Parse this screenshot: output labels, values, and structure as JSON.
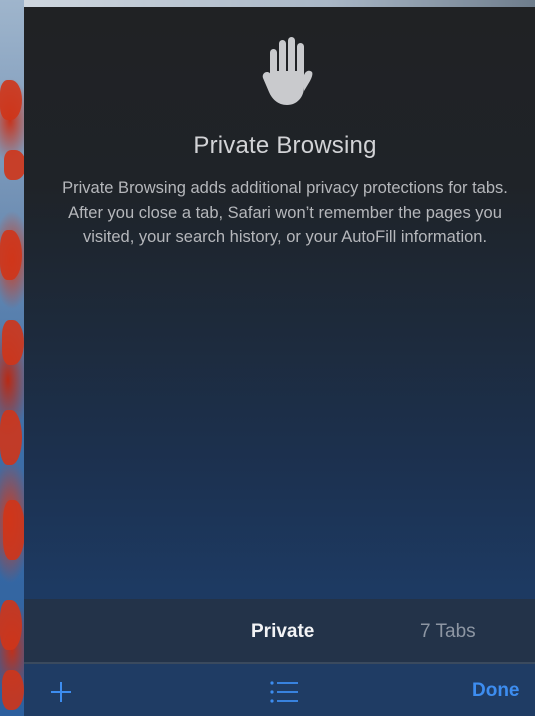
{
  "private_browsing": {
    "icon": "hand-stop-icon",
    "title": "Private Browsing",
    "description": "Private Browsing adds additional privacy protections for tabs. After you close a tab, Safari won’t remember the pages you visited, your search history, or your AutoFill information."
  },
  "tab_selector": {
    "private_label": "Private",
    "tabs_label": "7 Tabs"
  },
  "toolbar": {
    "add_icon": "plus-icon",
    "tab_groups_icon": "list-icon",
    "done_label": "Done"
  },
  "colors": {
    "accent": "#3d8df0",
    "panel_top": "#202224",
    "panel_bottom": "#1f3f6a"
  }
}
